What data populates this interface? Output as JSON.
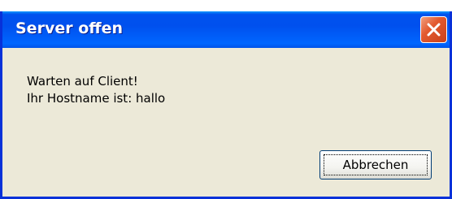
{
  "dialog": {
    "title": "Server offen",
    "message_lines": [
      "Warten auf Client!",
      "Ihr Hostname ist: hallo"
    ],
    "cancel_label": "Abbrechen"
  },
  "colors": {
    "titlebar": "#0053ee",
    "client_background": "#ece9d8",
    "close_button": "#e35a2f"
  },
  "icons": {
    "close": "close-icon"
  }
}
